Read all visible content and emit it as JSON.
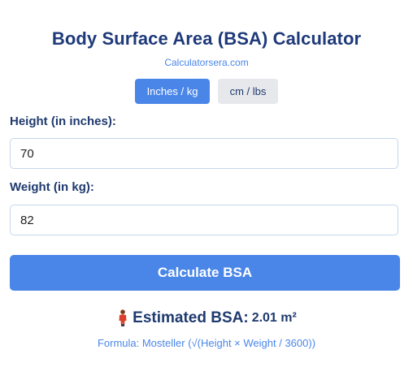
{
  "header": {
    "title": "Body Surface Area (BSA) Calculator",
    "subtitle": "Calculatorsera.com"
  },
  "units": {
    "options": [
      "Inches / kg",
      "cm / lbs"
    ],
    "selected": "Inches / kg"
  },
  "form": {
    "height_label": "Height (in inches):",
    "height_value": "70",
    "weight_label": "Weight (in kg):",
    "weight_value": "82",
    "submit_label": "Calculate BSA"
  },
  "result": {
    "icon": "standing-person-icon",
    "label": "Estimated BSA:",
    "value": "2.01 m²"
  },
  "formula": {
    "text": "Formula: Mosteller (√(Height × Weight / 3600))"
  },
  "colors": {
    "accent": "#4a86e8",
    "title": "#1f3a7a",
    "inactive_button": "#e6e8ec",
    "input_border": "#c5d6ea"
  }
}
